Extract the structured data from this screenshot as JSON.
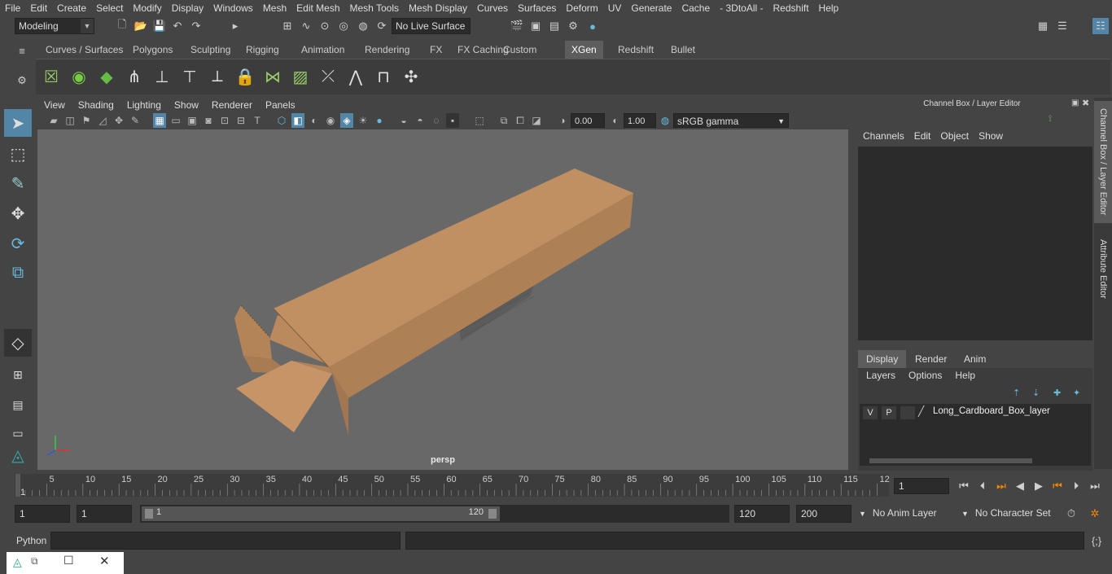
{
  "menubar": [
    "File",
    "Edit",
    "Create",
    "Select",
    "Modify",
    "Display",
    "Windows",
    "Mesh",
    "Edit Mesh",
    "Mesh Tools",
    "Mesh Display",
    "Curves",
    "Surfaces",
    "Deform",
    "UV",
    "Generate",
    "Cache",
    "- 3DtoAll -",
    "Redshift",
    "Help"
  ],
  "status": {
    "mode": "Modeling",
    "live_surface": "No Live Surface"
  },
  "shelf_tabs": [
    "Curves / Surfaces",
    "Polygons",
    "Sculpting",
    "Rigging",
    "Animation",
    "Rendering",
    "FX",
    "FX Caching",
    "Custom",
    "XGen",
    "Redshift",
    "Bullet"
  ],
  "shelf_active": "XGen",
  "viewport": {
    "menu": [
      "View",
      "Shading",
      "Lighting",
      "Show",
      "Renderer",
      "Panels"
    ],
    "exposure": "0.00",
    "gamma": "1.00",
    "color_space": "sRGB gamma",
    "camera": "persp"
  },
  "channel_box": {
    "title": "Channel Box / Layer Editor",
    "menu": [
      "Channels",
      "Edit",
      "Object",
      "Show"
    ]
  },
  "layer_editor": {
    "tabs": [
      "Display",
      "Render",
      "Anim"
    ],
    "active_tab": "Display",
    "menu": [
      "Layers",
      "Options",
      "Help"
    ],
    "layer": {
      "v": "V",
      "p": "P",
      "name": "Long_Cardboard_Box_layer"
    }
  },
  "side_tabs": [
    "Channel Box / Layer Editor",
    "Attribute Editor"
  ],
  "timeline": {
    "ticks": [
      "5",
      "10",
      "15",
      "20",
      "25",
      "30",
      "35",
      "40",
      "45",
      "50",
      "55",
      "60",
      "65",
      "70",
      "75",
      "80",
      "85",
      "90",
      "95",
      "100",
      "105",
      "110",
      "115",
      "12"
    ],
    "start_label": "1",
    "current_frame": "1"
  },
  "range": {
    "start": "1",
    "playback_start": "1",
    "slider_start": "1",
    "slider_end": "120",
    "playback_end": "120",
    "end": "200",
    "anim_layer": "No Anim Layer",
    "character_set": "No Character Set"
  },
  "cmdline": {
    "label": "Python"
  },
  "colors": {
    "accent": "#5285a6",
    "box": "#b8875a",
    "viewport_bg": "#686868"
  }
}
